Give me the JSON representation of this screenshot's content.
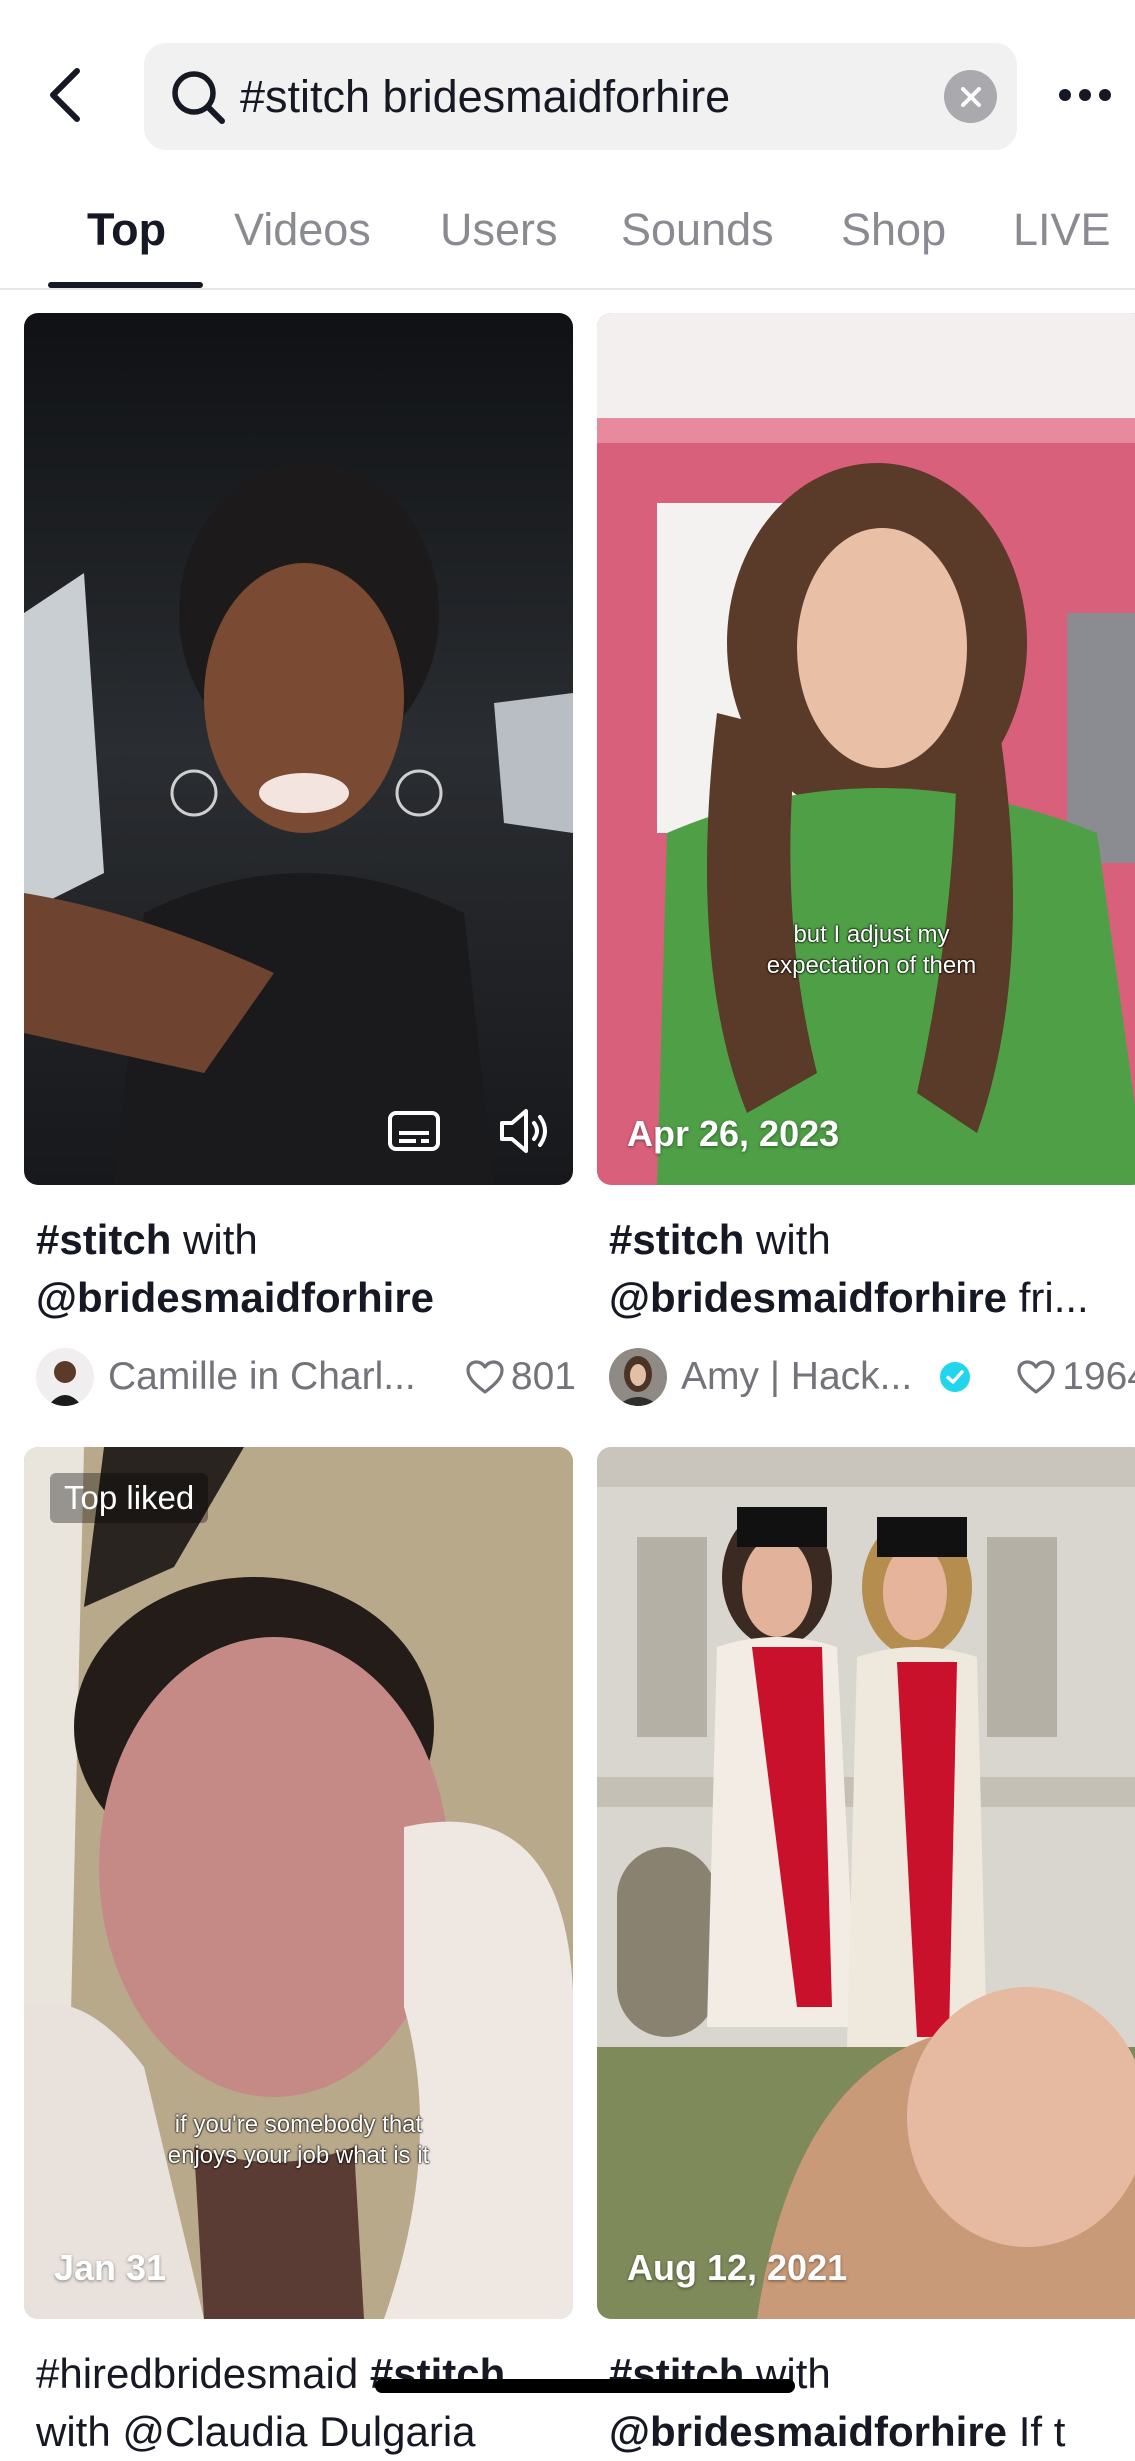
{
  "search": {
    "query": "#stitch bridesmaidforhire"
  },
  "tabs": [
    {
      "label": "Top",
      "active": true
    },
    {
      "label": "Videos"
    },
    {
      "label": "Users"
    },
    {
      "label": "Sounds"
    },
    {
      "label": "Shop"
    },
    {
      "label": "LIVE"
    }
  ],
  "results": [
    {
      "title_bold": "#stitch",
      "title_rest": " with",
      "title_line2_bold": "@bridesmaidforhire",
      "title_line2_rest": "",
      "author": "Camille in Charl...",
      "likes": "801"
    },
    {
      "title_bold": "#stitch",
      "title_rest": " with",
      "title_line2_bold": "@bridesmaidforhire",
      "title_line2_rest": " fri...",
      "date": "Apr 26, 2023",
      "overlay_caption_1": "but I adjust my",
      "overlay_caption_2": "expectation of them",
      "author": "Amy | Hack...",
      "verified": true,
      "likes": "1964"
    },
    {
      "badge": "Top liked",
      "date": "Jan 31",
      "overlay_caption_1": "if you're somebody that",
      "overlay_caption_2": "enjoys your job what is it",
      "title_rest": "#hiredbridesmaid ",
      "title_bold": "#stitch",
      "title_line2": "with @Claudia Dulgaria"
    },
    {
      "date": "Aug 12, 2021",
      "title_bold": "#stitch",
      "title_rest": " with",
      "title_line2_bold": "@bridesmaidforhire",
      "title_line2_rest": " If t"
    }
  ]
}
